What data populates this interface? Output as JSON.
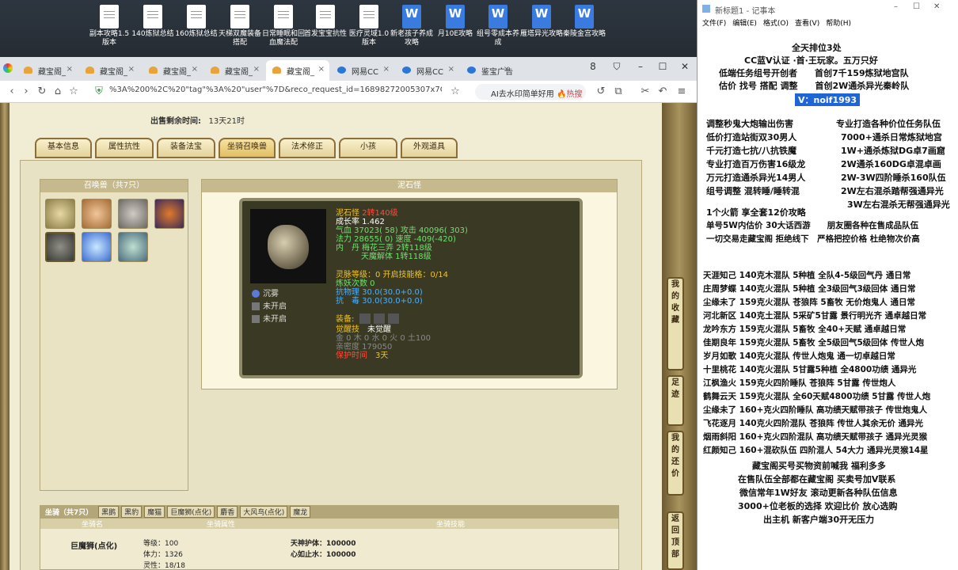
{
  "desktop": {
    "icons": [
      {
        "label": "副本攻略1.5版本",
        "type": "txt"
      },
      {
        "label": "140炼狱总结",
        "type": "txt"
      },
      {
        "label": "160炼狱总结",
        "type": "txt"
      },
      {
        "label": "天梯双魔装备搭配",
        "type": "txt"
      },
      {
        "label": "日常睡眠和回血魔法配",
        "type": "txt"
      },
      {
        "label": "首发宝宝抗性",
        "type": "txt"
      },
      {
        "label": "医疗灵域1.0版本",
        "type": "txt"
      },
      {
        "label": "新老孩子养成攻略",
        "type": "doc"
      },
      {
        "label": "月10E攻略",
        "type": "doc"
      },
      {
        "label": "组号零成本养成",
        "type": "doc"
      },
      {
        "label": "雁塔异光攻略",
        "type": "doc"
      },
      {
        "label": "秦陵金宫攻略",
        "type": "doc"
      }
    ]
  },
  "browser": {
    "tabs": [
      "藏宝阁_",
      "藏宝阁_",
      "藏宝阁_",
      "藏宝阁_",
      "藏宝阁_",
      "网易CC",
      "网易CC",
      "鉴宝广告"
    ],
    "window_buttons": [
      "8",
      "⛉",
      "–",
      "☐",
      "✕"
    ],
    "url": "%3A%200%2C%20\"tag\"%3A%20\"user\"%7D&reco_request_id=16898272005307x7Cy",
    "ai_text": "AI去水印简单好用",
    "ai_hot": "🔥热搜",
    "nav": [
      "‹",
      "›",
      "↻",
      "⌂",
      "☆"
    ]
  },
  "game": {
    "sell_time_label": "出售剩余时间:",
    "sell_time_value": "13天21时",
    "tabs": [
      "基本信息",
      "属性抗性",
      "装备法宝",
      "坐骑召唤兽",
      "法术修正",
      "小孩",
      "外观道具"
    ],
    "pets_title": "召唤兽（共7只）",
    "detail_title": "泥石怪",
    "pet": {
      "name": "泥石怪",
      "level": "2转140级",
      "growth": "成长率 1.462",
      "hp": "气血 37023( 58) 攻击 40096( 303)",
      "mp": "法力 28655( 0) 速度 -409(-420)",
      "inner": "内　丹 梅花三弄 2转118级",
      "inner2": "天魔解体 1转118级",
      "spirit": "灵脉等级：0 开启技能格：0/14",
      "refine": "炼妖次数 0",
      "phys": "抗物理 30.0(30.0+0.0)",
      "poison": "抗　毒 30.0(30.0+0.0)",
      "equip": "装备:",
      "awake_label": "觉醒技",
      "awake_value": "未觉醒",
      "elements": "金 0 木 0 水 0 火 0 土100",
      "intimacy": "亲密度 179050",
      "protect_label": "保护时间",
      "protect_value": "3天",
      "skills": [
        "沉雾",
        "未开启",
        "未开启"
      ]
    },
    "mount": {
      "title": "坐骑（共7只）",
      "tabs": [
        "黑鹅",
        "黑豹",
        "魔猫",
        "巨魔狮(点化)",
        "麝香",
        "大风鸟(点化)",
        "魔龙"
      ],
      "headers": [
        "坐骑名",
        "坐骑属性",
        "坐骑技能"
      ],
      "name": "巨魔狮(点化)",
      "attrs": [
        "等级：100",
        "体力：1326",
        "灵性：18/18"
      ],
      "skills": [
        "天神护体：100000",
        "心如止水：100000"
      ]
    },
    "side": [
      "我的收藏",
      "足迹",
      "我的还价",
      "返回顶部"
    ]
  },
  "notepad": {
    "title": "新标题1 - 记事本",
    "menu": [
      "文件(F)",
      "编辑(E)",
      "格式(O)",
      "查看(V)",
      "帮助(H)"
    ],
    "lines_center": [
      "全天排位3处",
      "CC蓝V认证 ·首·王玩家。五万只好",
      "低端任务组号开创者　　首创7千159炼狱地宫队",
      "估价 找号 搭配 调整　　首创2W通杀异光秦岭队"
    ],
    "vchat": "V：noif1993",
    "block1": [
      "调整秒鬼大炮输出伤害",
      "低价打造站街双30男人",
      "千元打造七抗/八抗铁魔",
      "专业打造百万伤害16级龙",
      "万元打造通杀异光14男人",
      "组号调整 混转睡/睡转混"
    ],
    "block1r": [
      "专业打造各种价位任务队伍",
      "7000+通杀日常炼狱地宫",
      "1W+通杀炼狱DG卓7画窟",
      "2W通杀160DG卓混卓画",
      "2W-3W四阶睡杀160队伍",
      "2W左右混杀踏帮强通异光",
      "3W左右混杀无帮强通异光"
    ],
    "block2": [
      "1个火箭 享全套12价攻略",
      "单号5W内估价 30大话西游　　朋友圈各种在售成品队伍",
      "一切交易走藏宝阁 拒绝线下　严格把控价格 杜绝物次价高"
    ],
    "list": [
      "天涯知己 140克木混队 5种植 全队4-5级回气丹 通日常",
      "庄周梦蝶 140克火混队 5种植 全3级回气3级回体 通日常",
      "尘缘未了 159克火混队 苍狼阵 5畜牧 无价炮鬼人 通日常",
      "河北新区 140克土混队 5采矿5甘露 景行明光齐 通卓越日常",
      "龙吟东方 159克火混队 5畜牧 全40+天赋 通卓越日常",
      "佳期良年 159克火混队 5畜牧 全5级回气5级回体 传世人炮",
      "岁月如歌 140克火混队 传世人炮鬼 通一切卓越日常",
      "十里桃花 140克火混队 5甘露5种植 全4800功绩 通异光",
      "江枫渔火 159克火四阶睡队 苍狼阵 5甘露 传世炮人",
      "鹤舞云天 159克火混队 全60天赋4800功绩 5甘露 传世人炮",
      "尘缘未了 160+克火四阶睡队 高功绩天赋带孩子 传世炮鬼人",
      "飞花逐月 140克火四阶混队 苍狼阵 传世人其余无价 通异光",
      "烟雨斜阳 160+克火四阶混队 高功绩天赋带孩子 通异光灵猴",
      "红颜知己 160+混砍队伍 四阶混人 54大力 通异光灵猴14星"
    ],
    "footer": [
      "藏宝阁买号买物资前喊我 福利多多",
      "在售队伍全部都在藏宝阁 买卖号加V联系",
      "微信常年1W好友 滚动更新各种队伍信息",
      "3000+位老板的选择 欢迎比价 放心选购",
      "出主机 新客户端30开无压力"
    ]
  },
  "colors": {
    "accent": "#1e66d6",
    "pet_level": "#f4c21c",
    "pet_green": "#6ee06e",
    "pet_red": "#ff4a3a"
  }
}
